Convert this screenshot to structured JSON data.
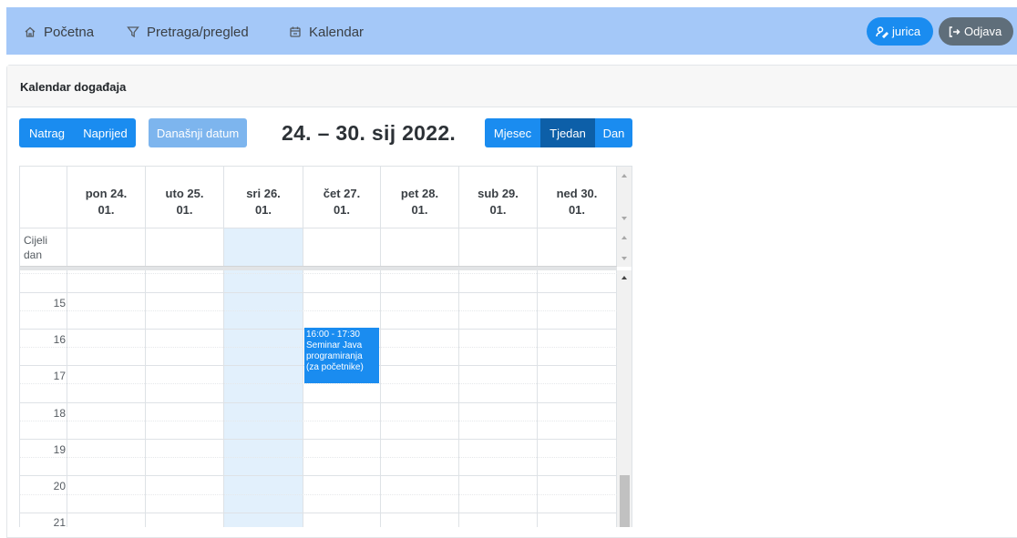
{
  "nav": {
    "items": [
      {
        "label": "Početna",
        "icon": "home-icon"
      },
      {
        "label": "Pretraga/pregled",
        "icon": "filter-icon"
      },
      {
        "label": "Kalendar",
        "icon": "calendar-icon"
      }
    ],
    "user_label": "jurica",
    "logout_label": "Odjava"
  },
  "card": {
    "title": "Kalendar događaja"
  },
  "toolbar": {
    "back_label": "Natrag",
    "next_label": "Naprijed",
    "today_label": "Današnji datum",
    "title": "24. – 30. sij 2022.",
    "month_label": "Mjesec",
    "week_label": "Tjedan",
    "day_label": "Dan",
    "active_view": "Tjedan"
  },
  "calendar": {
    "days": [
      {
        "name": "pon 24.",
        "date": "01."
      },
      {
        "name": "uto 25.",
        "date": "01."
      },
      {
        "name": "sri 26.",
        "date": "01."
      },
      {
        "name": "čet 27.",
        "date": "01."
      },
      {
        "name": "pet 28.",
        "date": "01."
      },
      {
        "name": "sub 29.",
        "date": "01."
      },
      {
        "name": "ned 30.",
        "date": "01."
      }
    ],
    "today_index": 2,
    "allday_label_1": "Cijeli",
    "allday_label_2": "dan",
    "hours": [
      "15",
      "16",
      "17",
      "18",
      "19",
      "20",
      "21"
    ],
    "event": {
      "time": "16:00 - 17:30",
      "title_line1": "Seminar Java",
      "title_line2": "programiranja",
      "title_line3": "(za početnike)",
      "day": "čet 27."
    }
  },
  "colors": {
    "navbar": "#a4c8f8",
    "primary": "#1a8cf0",
    "primary_active": "#0d5fa8",
    "today_bg": "#e2f0fc",
    "logout": "#5f6e7a"
  }
}
